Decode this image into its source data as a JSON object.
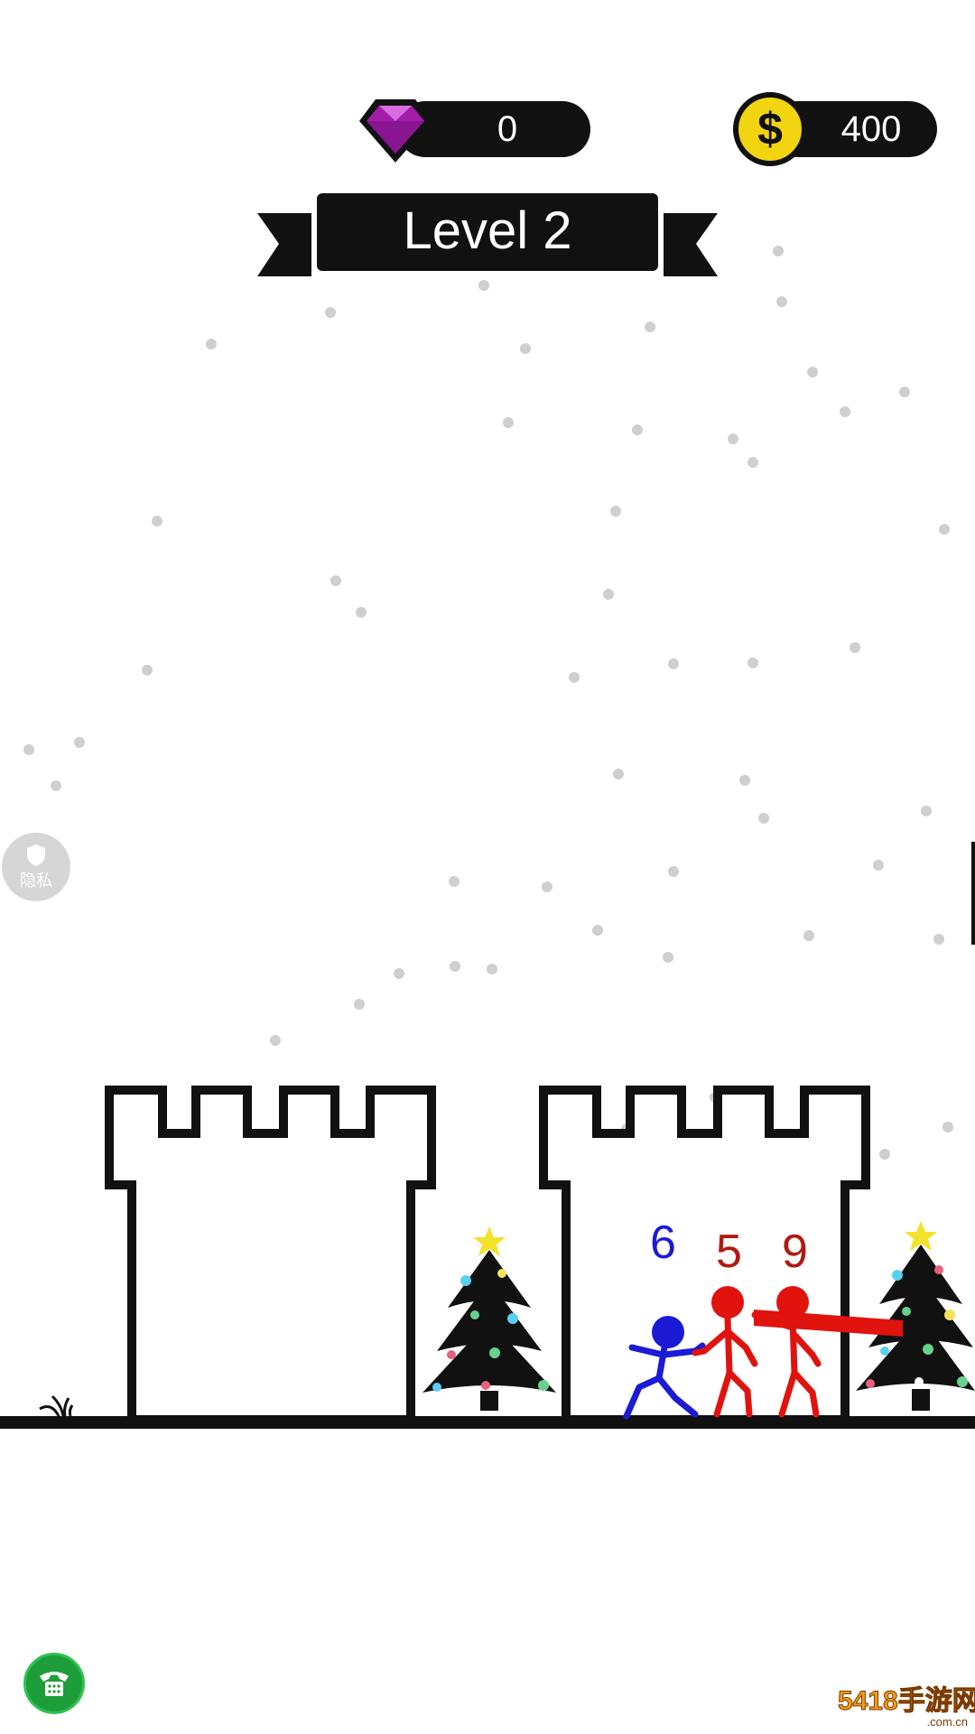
{
  "hud": {
    "gems": "0",
    "coins": "400",
    "coin_symbol": "$",
    "level_label": "Level 2"
  },
  "units": [
    {
      "power": "6",
      "team": "player",
      "color": "#1b1bd6"
    },
    {
      "power": "5",
      "team": "enemy",
      "color": "#b01a10"
    },
    {
      "power": "9",
      "team": "enemy",
      "color": "#b01a10"
    }
  ],
  "privacy": {
    "label": "隐私"
  },
  "watermark": {
    "text": "5418手游网",
    "sub": ".com.cn"
  },
  "colors": {
    "gem": "#a21ea8",
    "coin": "#f2d410",
    "player": "#1b1bd6",
    "enemy": "#e0130f"
  }
}
